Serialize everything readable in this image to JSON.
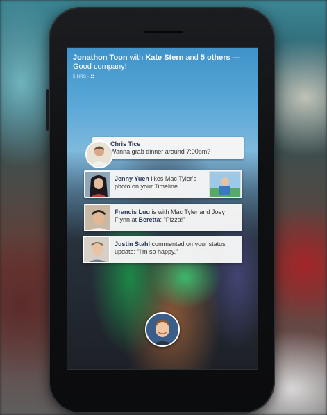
{
  "story": {
    "author": "Jonathon Toon",
    "with_word": "with",
    "tagged": "Kate Stern",
    "and_word": "and",
    "others": "5 others",
    "caption": "— Good company!",
    "time": "5 HRS",
    "separator": "·"
  },
  "notifications": [
    {
      "name": "Chris Tice",
      "text": "Wanna grab dinner around 7:00pm?"
    },
    {
      "name": "Jenny Yuen",
      "text": "likes Mac Tyler's photo on your Timeline."
    },
    {
      "name": "Francis Luu",
      "text_a": "is with Mac Tyler and Joey Flynn at",
      "place": "Beretta",
      "text_b": ": \"Pizza!\""
    },
    {
      "name": "Justin Stahl",
      "text": "commented on your status update: \"I'm so happy.\""
    }
  ],
  "colors": {
    "link": "#2b3a5a",
    "card_bg": "#f6f6f6",
    "accent_green": "#2aa86a"
  },
  "icons": {
    "audience": "friends-icon",
    "chat_head": "chat-head-avatar"
  }
}
